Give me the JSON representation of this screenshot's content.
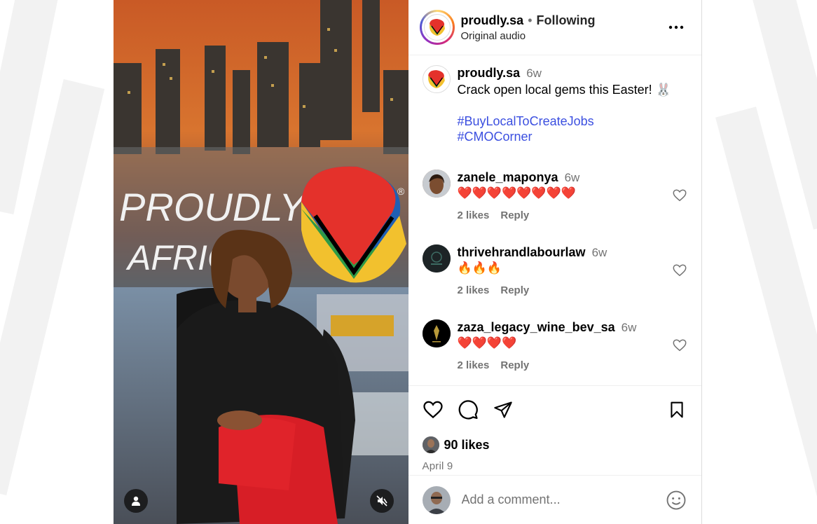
{
  "post": {
    "username": "proudly.sa",
    "separator": "•",
    "follow_status": "Following",
    "audio": "Original audio",
    "more_icon": "more-horizontal-icon"
  },
  "media": {
    "sign_line1": "PROUDLY",
    "sign_line2": "AFRICA",
    "registered": "®",
    "user_tag_icon": "person-icon",
    "mute_icon": "speaker-muted-icon"
  },
  "caption": {
    "username": "proudly.sa",
    "time": "6w",
    "text": "Crack open local gems this Easter! 🐰",
    "hashtags": [
      "#BuyLocalToCreateJobs",
      "#CMOCorner"
    ]
  },
  "comments": [
    {
      "username": "zanele_maponya",
      "time": "6w",
      "text": "❤️❤️❤️❤️❤️❤️❤️❤️",
      "likes": "2 likes",
      "reply": "Reply"
    },
    {
      "username": "thrivehrandlabourlaw",
      "time": "6w",
      "text": "🔥🔥🔥",
      "likes": "2 likes",
      "reply": "Reply"
    },
    {
      "username": "zaza_legacy_wine_bev_sa",
      "time": "6w",
      "text": "❤️❤️❤️❤️",
      "likes": "2 likes",
      "reply": "Reply"
    }
  ],
  "actions": {
    "like_icon": "heart-icon",
    "comment_icon": "comment-bubble-icon",
    "share_icon": "paper-plane-icon",
    "save_icon": "bookmark-icon"
  },
  "likes": "90 likes",
  "date": "April 9",
  "add_comment": {
    "placeholder": "Add a comment...",
    "emoji_icon": "smiley-icon"
  },
  "colors": {
    "hashtag": "#3b4fe0",
    "muted_text": "#737373",
    "logo_red": "#e4312b",
    "logo_green": "#2e9a47",
    "logo_yellow": "#f2c12e",
    "logo_blue": "#1f5fb4"
  }
}
